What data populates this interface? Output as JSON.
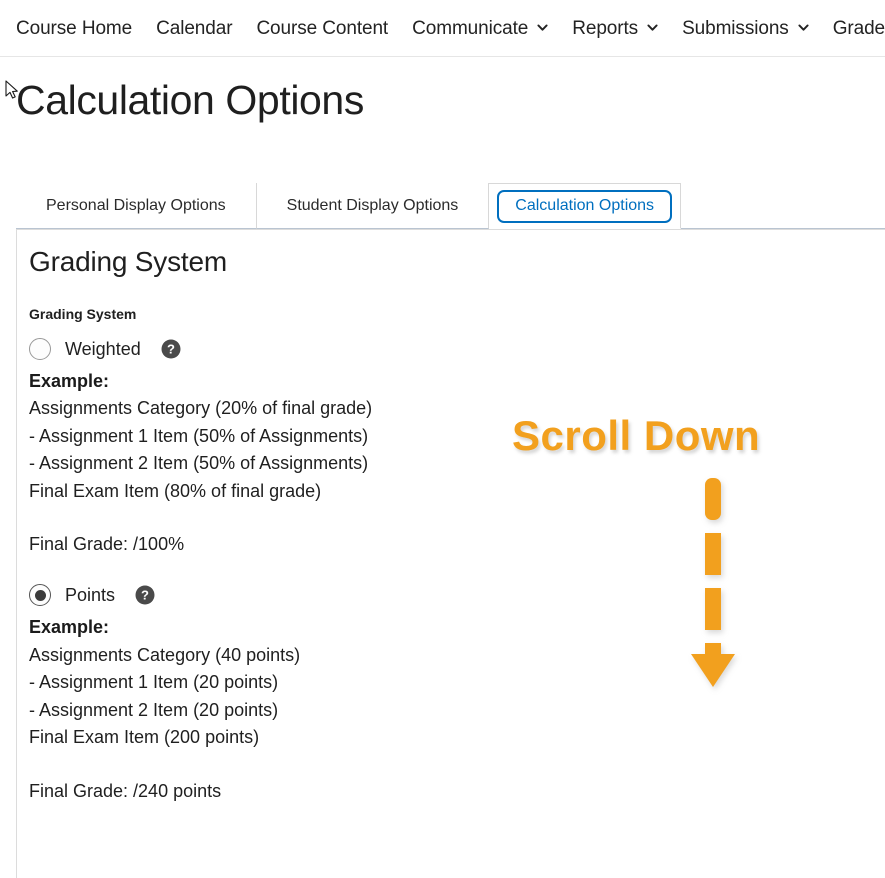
{
  "nav": {
    "items": [
      {
        "label": "Course Home",
        "has_caret": false
      },
      {
        "label": "Calendar",
        "has_caret": false
      },
      {
        "label": "Course Content",
        "has_caret": false
      },
      {
        "label": "Communicate",
        "has_caret": true
      },
      {
        "label": "Reports",
        "has_caret": true
      },
      {
        "label": "Submissions",
        "has_caret": true
      },
      {
        "label": "Grades",
        "has_caret": false
      }
    ]
  },
  "page": {
    "title": "Calculation Options"
  },
  "tabs": [
    {
      "label": "Personal Display Options",
      "active": false
    },
    {
      "label": "Student Display Options",
      "active": false
    },
    {
      "label": "Calculation Options",
      "active": true
    }
  ],
  "content": {
    "heading": "Grading System",
    "field_label": "Grading System",
    "options": [
      {
        "label": "Weighted",
        "selected": false,
        "help": "help-icon",
        "example_title": "Example:",
        "example_lines": [
          "Assignments Category (20% of final grade)",
          "- Assignment 1 Item (50% of Assignments)",
          "- Assignment 2 Item (50% of Assignments)",
          "Final Exam Item (80% of final grade)"
        ],
        "final_grade": "Final Grade: /100%"
      },
      {
        "label": "Points",
        "selected": true,
        "help": "help-icon",
        "example_title": "Example:",
        "example_lines": [
          "Assignments Category (40 points)",
          "- Assignment 1 Item (20 points)",
          "- Assignment 2 Item (20 points)",
          "Final Exam Item (200 points)"
        ],
        "final_grade": "Final Grade: /240 points"
      }
    ]
  },
  "annotation": {
    "text": "Scroll Down",
    "arrow": "down-arrow-dashed",
    "color": "#F2A01E"
  },
  "cursor": {
    "icon": "mouse-pointer"
  },
  "colors": {
    "accent_blue": "#006fbf",
    "annotation_orange": "#F2A01E",
    "text": "#1f1f1f",
    "border": "#dcdcdc"
  }
}
